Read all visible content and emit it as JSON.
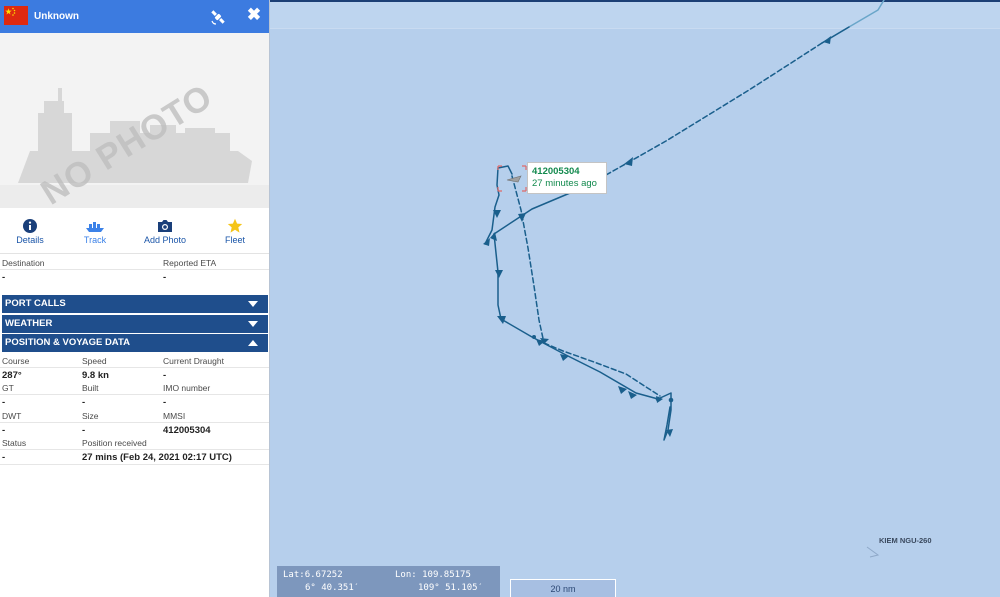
{
  "vessel": {
    "name": "Unknown",
    "flag_colors": {
      "field": "#de2910",
      "star": "#ffde00"
    }
  },
  "photo": {
    "watermark": "NO PHOTO"
  },
  "tabs": [
    {
      "label": "Details",
      "icon": "info-icon"
    },
    {
      "label": "Track",
      "icon": "ship-icon"
    },
    {
      "label": "Add Photo",
      "icon": "camera-icon"
    },
    {
      "label": "Fleet",
      "icon": "star-icon"
    }
  ],
  "destination": {
    "label": "Destination",
    "value": "-"
  },
  "eta": {
    "label": "Reported ETA",
    "value": "-"
  },
  "sections": {
    "port_calls": "PORT CALLS",
    "weather": "WEATHER",
    "position_voyage": "POSITION & VOYAGE DATA"
  },
  "voyage": {
    "course": {
      "label": "Course",
      "value": "287°"
    },
    "speed": {
      "label": "Speed",
      "value": "9.8 kn"
    },
    "draught": {
      "label": "Current Draught",
      "value": "-"
    },
    "gt": {
      "label": "GT",
      "value": "-"
    },
    "built": {
      "label": "Built",
      "value": "-"
    },
    "imo": {
      "label": "IMO number",
      "value": "-"
    },
    "dwt": {
      "label": "DWT",
      "value": "-"
    },
    "size": {
      "label": "Size",
      "value": "-"
    },
    "mmsi": {
      "label": "MMSI",
      "value": "412005304"
    },
    "status": {
      "label": "Status",
      "value": "-"
    },
    "position_received": {
      "label": "Position received",
      "value": "27 mins (Feb 24, 2021 02:17 UTC)"
    }
  },
  "map": {
    "tooltip": {
      "mmsi": "412005304",
      "time": "27 minutes ago"
    },
    "area_label": "KIEM NGU-260",
    "coords": {
      "lat_label": "Lat:",
      "lat_value": "6.67252",
      "lon_label": "Lon:",
      "lon_value": "109.85175",
      "lat_dms": "6° 40.351′",
      "lon_dms": "109° 51.105′"
    },
    "scale": "20 nm",
    "colors": {
      "track": "#1a5f8c",
      "sea": "#b6cfec",
      "tooltip_text": "#138a4e"
    }
  }
}
